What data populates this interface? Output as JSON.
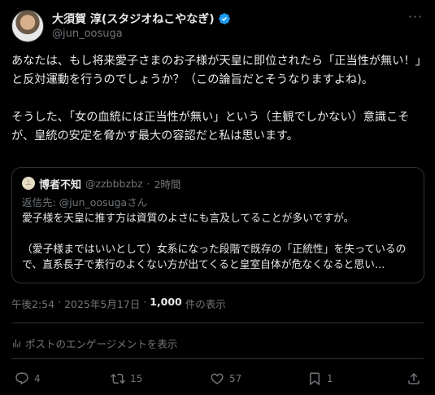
{
  "author": {
    "name": "大須賀 淳(スタジオねこやなぎ)",
    "handle": "@jun_oosuga"
  },
  "tweet": {
    "text": "あなたは、もし将来愛子さまのお子様が天皇に即位されたら「正当性が無い！」と反対運動を行うのでしょうか？（この論旨だとそうなりますよね)。\n\nそうした、「女の血統には正当性が無い」という（主観でしかない）意識こそが、皇統の安定を脅かす最大の容認だと私は思います。"
  },
  "quote": {
    "avatar_text": "⊥",
    "name": "博者不知",
    "handle": "@zzbbbzbz",
    "dot": "·",
    "time": "2時間",
    "reply_prefix": "返信先: ",
    "reply_mention": "@jun_oosuga",
    "reply_suffix": "さん",
    "body": "愛子様を天皇に推す方は資質のよさにも言及してることが多いですが。\n\n（愛子様まではいいとして）女系になった段階で既存の「正統性」を失っているので、直系長子で素行のよくない方が出てくると皇室自体が危なくなると思い..."
  },
  "meta": {
    "time": "午後2:54",
    "dot1": "·",
    "date": "2025年5月17日",
    "dot2": "·",
    "views": "1,000",
    "views_label": "件の表示"
  },
  "engagements_label": "ポストのエンゲージメントを表示",
  "actions": {
    "replies": "4",
    "reposts": "15",
    "likes": "57",
    "bookmarks": "1"
  },
  "colors": {
    "background": "#000000",
    "text": "#e7e9ea",
    "muted": "#71767b",
    "border": "#2f3336",
    "verified": "#1d9bf0"
  }
}
